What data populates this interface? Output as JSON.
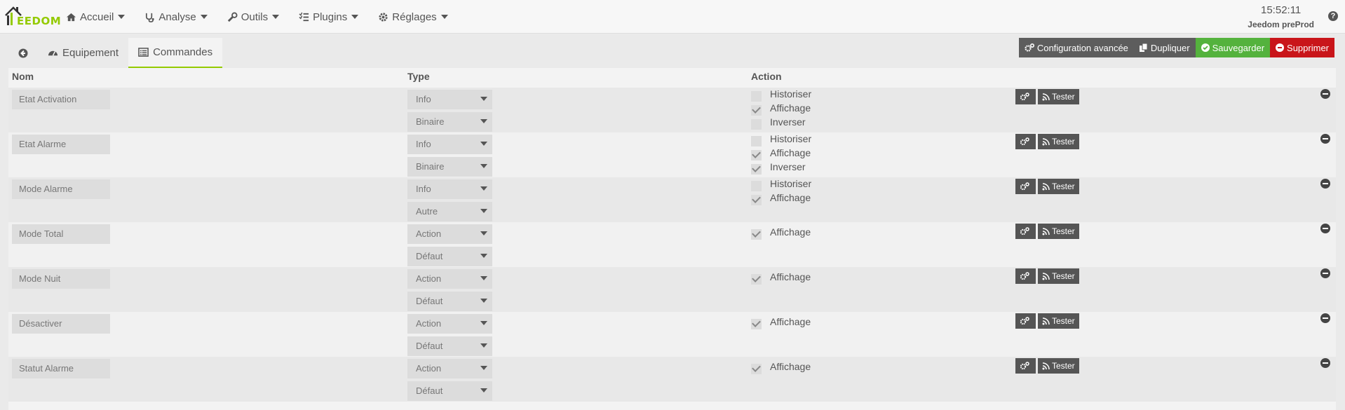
{
  "brand": {
    "name": "EEDOM"
  },
  "nav": {
    "items": [
      {
        "label": "Accueil",
        "icon": "home-icon"
      },
      {
        "label": "Analyse",
        "icon": "stethoscope-icon"
      },
      {
        "label": "Outils",
        "icon": "wrench-icon"
      },
      {
        "label": "Plugins",
        "icon": "tasks-icon"
      },
      {
        "label": "Réglages",
        "icon": "cog-icon"
      }
    ],
    "time": "15:52:11",
    "server": "Jeedom preProd",
    "help": "?"
  },
  "tabs": [
    {
      "label": "",
      "icon": "back-arrow-icon"
    },
    {
      "label": "Equipement",
      "icon": "tachometer-icon"
    },
    {
      "label": "Commandes",
      "icon": "list-alt-icon",
      "active": true
    }
  ],
  "actions": {
    "config": "Configuration avancée",
    "duplicate": "Dupliquer",
    "save": "Sauvegarder",
    "delete": "Supprimer"
  },
  "table": {
    "headers": {
      "name": "Nom",
      "type": "Type",
      "action": "Action"
    },
    "test_label": "Tester",
    "rows": [
      {
        "name": "Etat Activation",
        "type": "Info",
        "subtype": "Binaire",
        "checks": [
          {
            "label": "Historiser",
            "checked": false
          },
          {
            "label": "Affichage",
            "checked": true
          },
          {
            "label": "Inverser",
            "checked": false
          }
        ]
      },
      {
        "name": "Etat Alarme",
        "type": "Info",
        "subtype": "Binaire",
        "checks": [
          {
            "label": "Historiser",
            "checked": false
          },
          {
            "label": "Affichage",
            "checked": true
          },
          {
            "label": "Inverser",
            "checked": true
          }
        ]
      },
      {
        "name": "Mode Alarme",
        "type": "Info",
        "subtype": "Autre",
        "checks": [
          {
            "label": "Historiser",
            "checked": false
          },
          {
            "label": "Affichage",
            "checked": true
          }
        ]
      },
      {
        "name": "Mode Total",
        "type": "Action",
        "subtype": "Défaut",
        "checks": [
          {
            "label": "Affichage",
            "checked": true
          }
        ]
      },
      {
        "name": "Mode Nuit",
        "type": "Action",
        "subtype": "Défaut",
        "checks": [
          {
            "label": "Affichage",
            "checked": true
          }
        ]
      },
      {
        "name": "Désactiver",
        "type": "Action",
        "subtype": "Défaut",
        "checks": [
          {
            "label": "Affichage",
            "checked": true
          }
        ]
      },
      {
        "name": "Statut Alarme",
        "type": "Action",
        "subtype": "Défaut",
        "checks": [
          {
            "label": "Affichage",
            "checked": true
          }
        ]
      }
    ]
  },
  "colors": {
    "accent": "#94ca02",
    "save": "#54b23d",
    "delete": "#c9151a",
    "dark": "#5d5d5d"
  }
}
